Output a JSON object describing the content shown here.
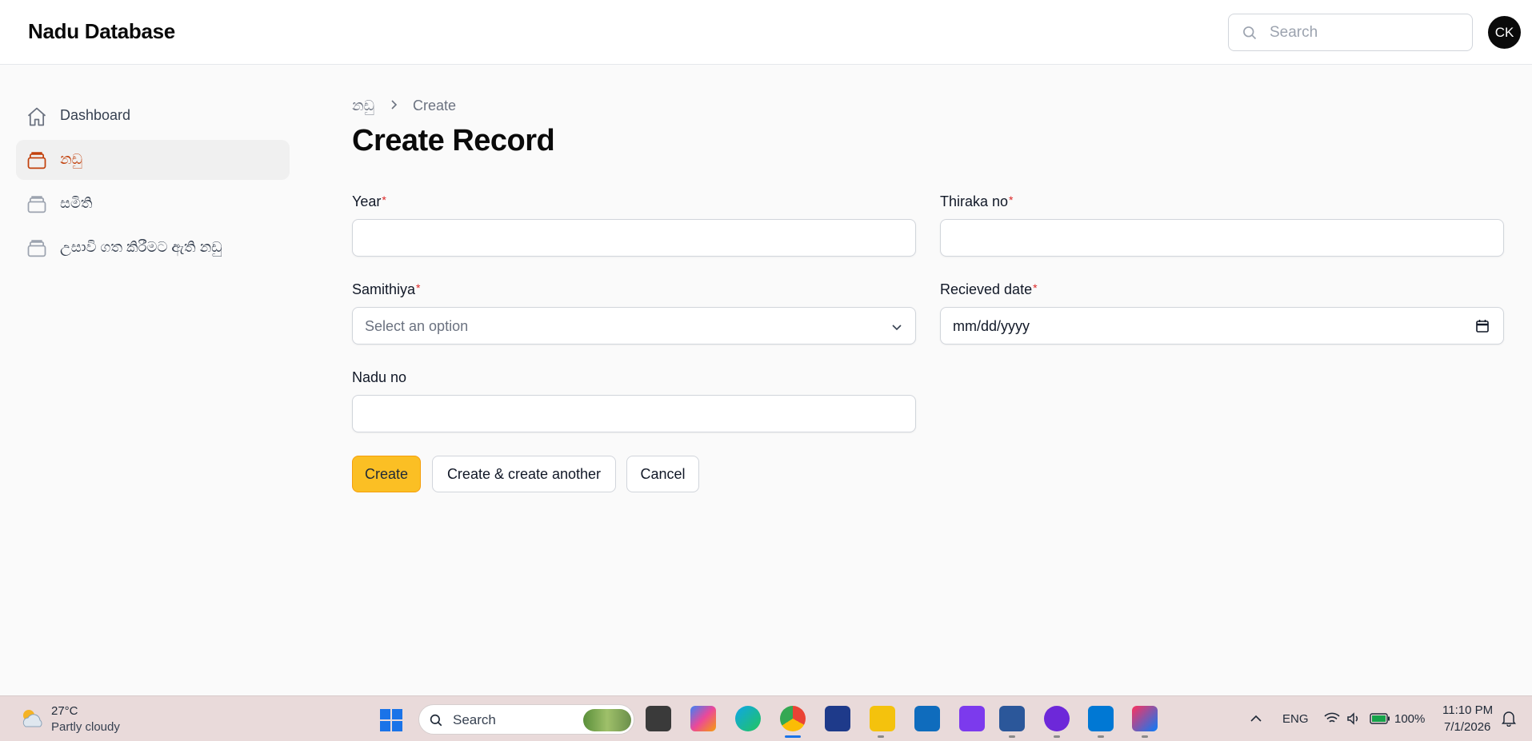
{
  "header": {
    "brand": "Nadu Database",
    "search_placeholder": "Search",
    "avatar_initials": "CK"
  },
  "sidebar": {
    "items": [
      {
        "label": "Dashboard",
        "icon": "home-icon",
        "active": false
      },
      {
        "label": "නඩු",
        "icon": "archive-box-icon",
        "active": true
      },
      {
        "label": "සමිති",
        "icon": "archive-box-icon",
        "active": false
      },
      {
        "label": "උසාවි ගත කිරීමට ඇති නඩු",
        "icon": "archive-box-icon",
        "active": false
      }
    ]
  },
  "breadcrumb": {
    "parent": "නඩු",
    "current": "Create"
  },
  "page": {
    "title": "Create Record"
  },
  "form": {
    "year": {
      "label": "Year",
      "required_mark": "*",
      "value": ""
    },
    "thiraka_no": {
      "label": "Thiraka no",
      "required_mark": "*",
      "value": ""
    },
    "samithiya": {
      "label": "Samithiya",
      "required_mark": "*",
      "placeholder": "Select an option"
    },
    "recieved_date": {
      "label": "Recieved date",
      "required_mark": "*",
      "placeholder": "mm/dd/yyyy"
    },
    "nadu_no": {
      "label": "Nadu no",
      "value": ""
    }
  },
  "actions": {
    "create": "Create",
    "create_another": "Create & create another",
    "cancel": "Cancel"
  },
  "colors": {
    "accent": "#fbbf24",
    "active_nav": "#c2410c",
    "required": "#dc2626"
  },
  "taskbar": {
    "weather_temp": "27°C",
    "weather_desc": "Partly cloudy",
    "search_label": "Search",
    "language": "ENG",
    "battery": "100%",
    "time": "11:10 PM",
    "date": "7/1/2026"
  }
}
